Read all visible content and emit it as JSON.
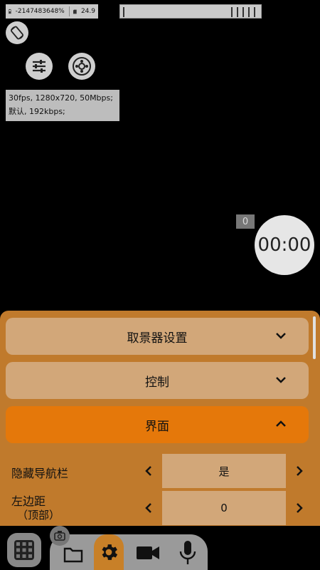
{
  "status": {
    "memory": "-2147483648%",
    "storage": "24.9"
  },
  "top_buttons": {
    "rotate": "rotate-icon",
    "settings": "sliders-icon",
    "gallery": "film-reel-icon"
  },
  "info": {
    "line1": "30fps, 1280x720, 50Mbps;",
    "line2": "默认, 192kbps;"
  },
  "counter": "0",
  "timer": "00:00",
  "panel": {
    "sections": [
      {
        "label": "取景器设置",
        "state": "collapsed"
      },
      {
        "label": "控制",
        "state": "collapsed"
      },
      {
        "label": "界面",
        "state": "expanded"
      }
    ],
    "rows": [
      {
        "label": "隐藏导航栏",
        "value": "是"
      },
      {
        "label_line1": "左边距",
        "label_line2": "（顶部）",
        "value": "0"
      }
    ]
  },
  "toolbar": [
    "grid-icon",
    "folder-icon",
    "gear-icon",
    "video-camera-icon",
    "microphone-icon"
  ],
  "colors": {
    "panel": "#c07a2c",
    "section_collapsed": "#d2a779",
    "section_expanded": "#e5780a"
  }
}
